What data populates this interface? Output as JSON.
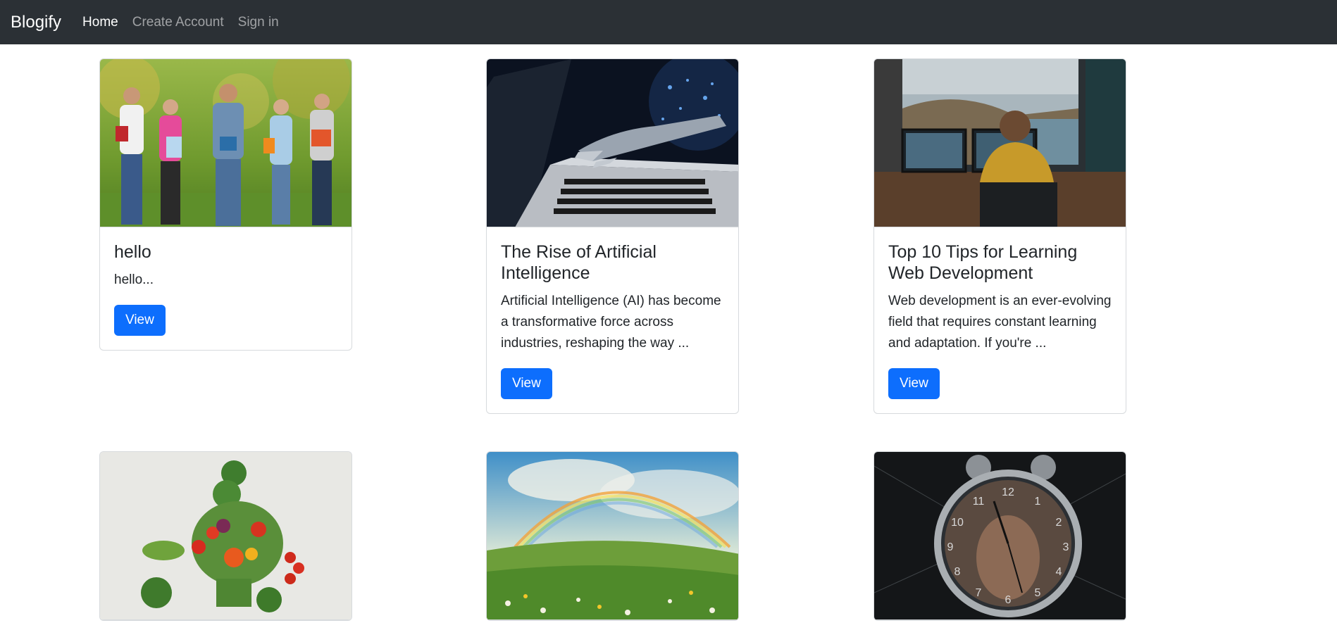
{
  "navbar": {
    "brand": "Blogify",
    "links": [
      {
        "label": "Home",
        "active": true
      },
      {
        "label": "Create Account",
        "active": false
      },
      {
        "label": "Sign in",
        "active": false
      }
    ]
  },
  "posts": [
    {
      "title": "hello",
      "excerpt": "hello...",
      "button": "View",
      "image": "students-photo"
    },
    {
      "title": "The Rise of Artificial Intelligence",
      "excerpt": "Artificial Intelligence (AI) has become a transformative force across industries, reshaping the way ...",
      "button": "View",
      "image": "robot-hand-laptop-photo"
    },
    {
      "title": "Top 10 Tips for Learning Web Development",
      "excerpt": "Web development is an ever-evolving field that requires constant learning and adaptation. If you're ...",
      "button": "View",
      "image": "developer-desk-photo"
    },
    {
      "title": "",
      "excerpt": "",
      "button": "",
      "image": "vegetables-figure-photo"
    },
    {
      "title": "",
      "excerpt": "",
      "button": "",
      "image": "rainbow-meadow-photo"
    },
    {
      "title": "",
      "excerpt": "",
      "button": "",
      "image": "clock-face-photo"
    }
  ],
  "colors": {
    "navbar_bg": "#2b3035",
    "primary_button": "#0d6efd"
  }
}
